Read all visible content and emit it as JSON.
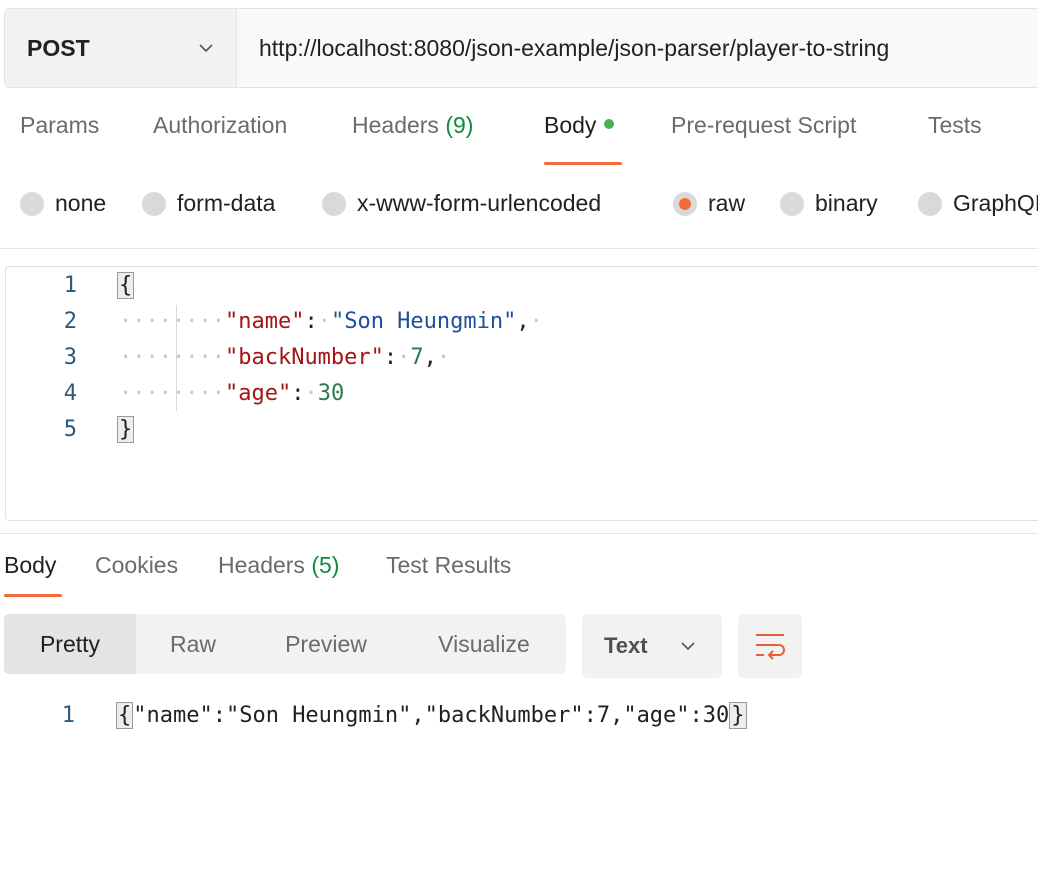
{
  "request": {
    "method": "POST",
    "url": "http://localhost:8080/json-example/json-parser/player-to-string"
  },
  "request_tabs": [
    {
      "label": "Params"
    },
    {
      "label": "Authorization"
    },
    {
      "label": "Headers",
      "count": "(9)"
    },
    {
      "label": "Body",
      "active": true
    },
    {
      "label": "Pre-request Script"
    },
    {
      "label": "Tests"
    }
  ],
  "body_types": [
    {
      "label": "none"
    },
    {
      "label": "form-data"
    },
    {
      "label": "x-www-form-urlencoded"
    },
    {
      "label": "raw",
      "selected": true
    },
    {
      "label": "binary"
    },
    {
      "label": "GraphQL"
    }
  ],
  "editor": {
    "line_numbers": [
      "1",
      "2",
      "3",
      "4",
      "5"
    ],
    "open_brace": "{",
    "close_brace": "}",
    "fields": [
      {
        "key": "\"name\"",
        "value": "\"Son Heungmin\"",
        "trail": ","
      },
      {
        "key": "\"backNumber\"",
        "value": "7",
        "trail": ","
      },
      {
        "key": "\"age\"",
        "value": "30",
        "trail": ""
      }
    ]
  },
  "response_tabs": [
    {
      "label": "Body",
      "active": true
    },
    {
      "label": "Cookies"
    },
    {
      "label": "Headers",
      "count": "(5)"
    },
    {
      "label": "Test Results"
    }
  ],
  "response_view": {
    "modes": [
      "Pretty",
      "Raw",
      "Preview",
      "Visualize"
    ],
    "active_mode": "Pretty",
    "format": "Text"
  },
  "response_body": {
    "line_number": "1",
    "open_brace": "{",
    "content": "\"name\":\"Son Heungmin\",\"backNumber\":7,\"age\":30",
    "close_brace": "}"
  },
  "colors": {
    "accent": "#f26b3a",
    "count_green": "#0f8a3f",
    "body_dot": "#4ab05a"
  },
  "icons": [
    "chevron-down-icon",
    "word-wrap-icon"
  ]
}
